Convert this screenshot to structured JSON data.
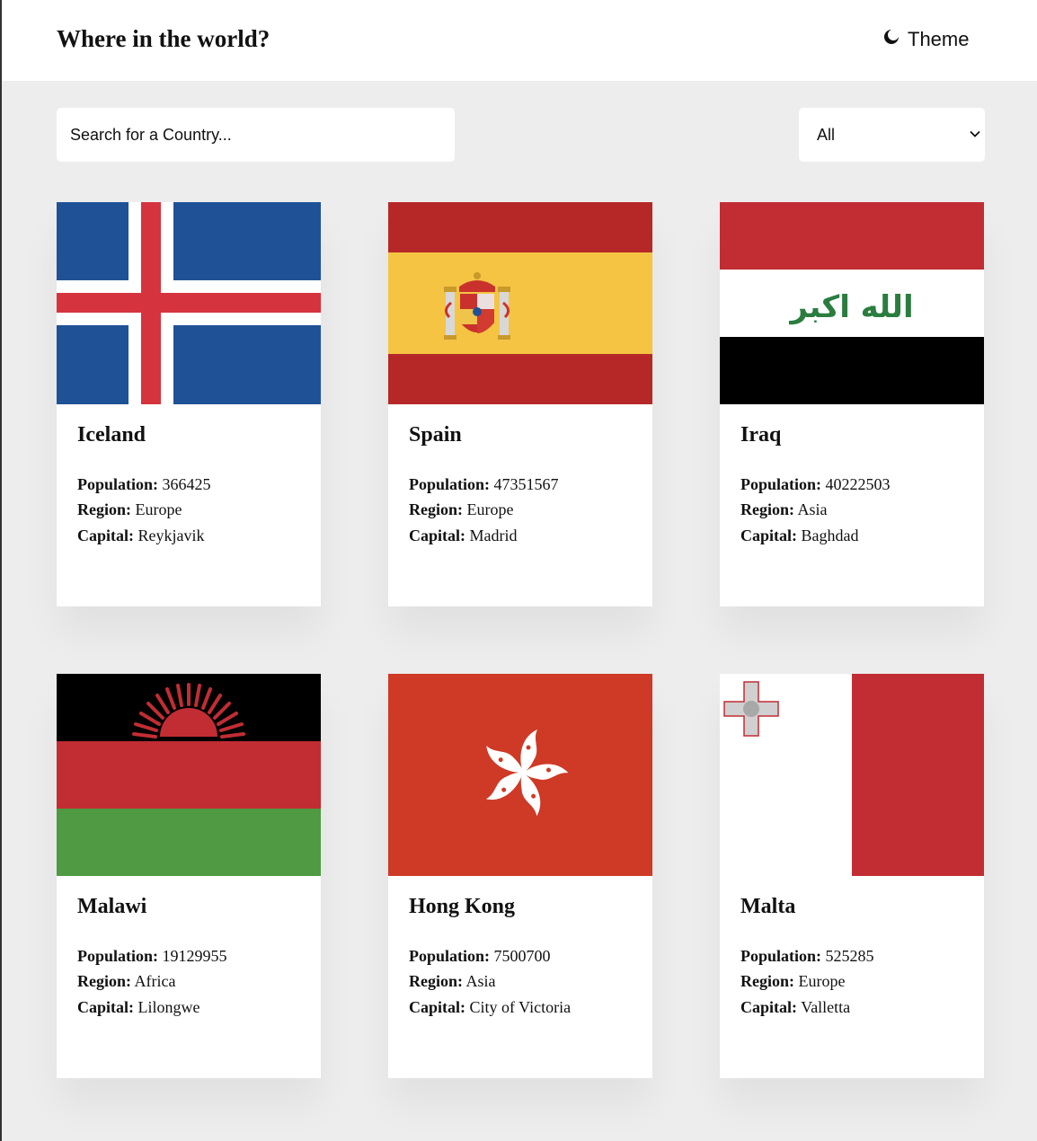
{
  "header": {
    "title": "Where in the world?",
    "theme_label": "Theme"
  },
  "search": {
    "placeholder": "Search for a Country..."
  },
  "filter": {
    "selected": "All"
  },
  "labels": {
    "population": "Population:",
    "region": "Region:",
    "capital": "Capital:"
  },
  "countries": [
    {
      "name": "Iceland",
      "population": "366425",
      "region": "Europe",
      "capital": "Reykjavik"
    },
    {
      "name": "Spain",
      "population": "47351567",
      "region": "Europe",
      "capital": "Madrid"
    },
    {
      "name": "Iraq",
      "population": "40222503",
      "region": "Asia",
      "capital": "Baghdad"
    },
    {
      "name": "Malawi",
      "population": "19129955",
      "region": "Africa",
      "capital": "Lilongwe"
    },
    {
      "name": "Hong Kong",
      "population": "7500700",
      "region": "Asia",
      "capital": "City of Victoria"
    },
    {
      "name": "Malta",
      "population": "525285",
      "region": "Europe",
      "capital": "Valletta"
    }
  ],
  "flags": {
    "iraq_inscription": "الله اكبر"
  },
  "colors": {
    "background": "#ededed",
    "surface": "#ffffff",
    "text": "#111111"
  }
}
